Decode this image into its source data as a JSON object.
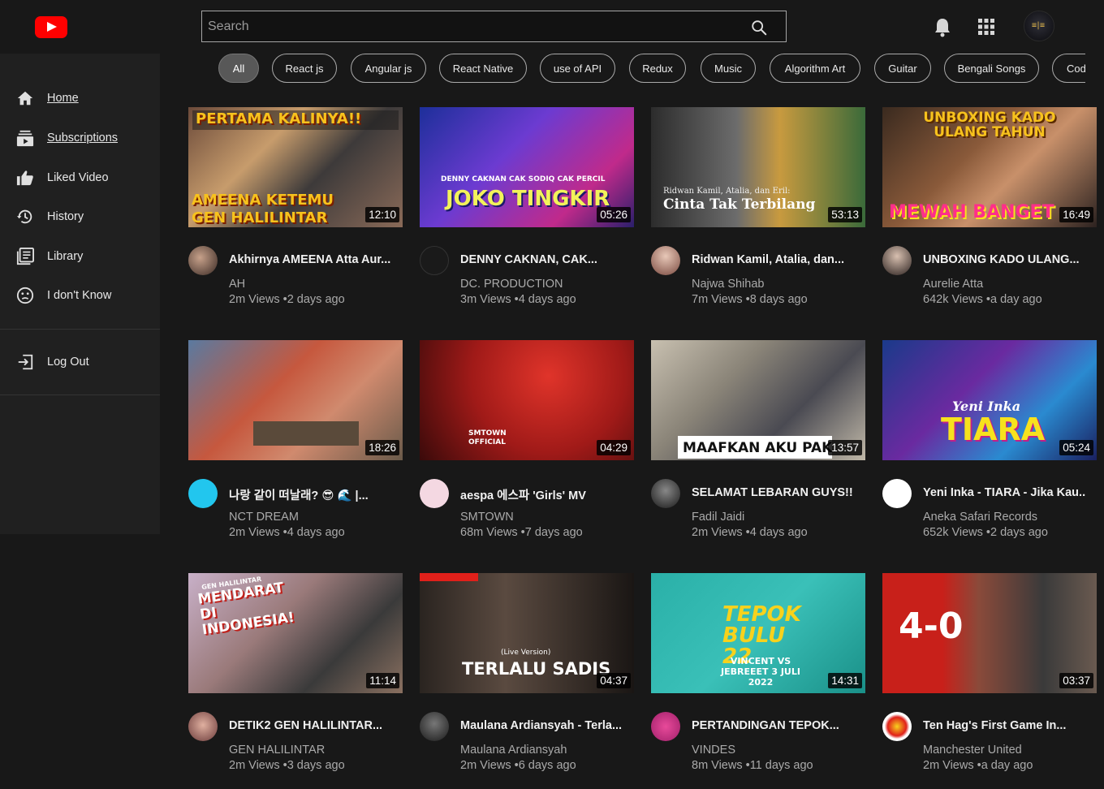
{
  "header": {
    "search_placeholder": "Search",
    "avatar_text": "≡|≡"
  },
  "sidebar": {
    "items": [
      {
        "label": "Home",
        "icon": "home-icon"
      },
      {
        "label": "Subscriptions",
        "icon": "subscriptions-icon"
      },
      {
        "label": "Liked Video",
        "icon": "thumbs-up-icon"
      },
      {
        "label": "History",
        "icon": "history-icon"
      },
      {
        "label": "Library",
        "icon": "library-icon"
      },
      {
        "label": "I don't Know",
        "icon": "confused-face-icon"
      }
    ],
    "logout_label": "Log Out"
  },
  "chips": [
    "All",
    "React js",
    "Angular js",
    "React Native",
    "use of API",
    "Redux",
    "Music",
    "Algorithm Art",
    "Guitar",
    "Bengali Songs",
    "Cod"
  ],
  "active_chip": "All",
  "videos": [
    {
      "title": "Akhirnya AMEENA Atta Aur...",
      "channel": "AH",
      "meta": "2m Views •2 days ago",
      "duration": "12:10",
      "thumb_text": "PERTAMA KALINYA!!",
      "thumb_text2": "AMEENA KETEMU GEN HALILINTAR"
    },
    {
      "title": "DENNY CAKNAN, CAK...",
      "channel": "DC. PRODUCTION",
      "meta": "3m Views •4 days ago",
      "duration": "05:26",
      "thumb_text": "JOKO TINGKIR",
      "thumb_text2": "DENNY CAKNAN   CAK SODIQ   CAK PERCIL"
    },
    {
      "title": "Ridwan Kamil, Atalia, dan...",
      "channel": "Najwa Shihab",
      "meta": "7m Views •8 days ago",
      "duration": "53:13",
      "thumb_text": "Cinta Tak Terbilang",
      "thumb_text2": "Ridwan Kamil, Atalia, dan Eril:"
    },
    {
      "title": "UNBOXING KADO ULANG...",
      "channel": "Aurelie Atta",
      "meta": "642k Views •a day ago",
      "duration": "16:49",
      "thumb_text": "UNBOXING KADO ULANG TAHUN",
      "thumb_text2": "MEWAH BANGET"
    },
    {
      "title": "나랑 같이 떠날래? 😎 🌊 |...",
      "channel": "NCT DREAM",
      "meta": "2m Views •4 days ago",
      "duration": "18:26",
      "thumb_text": "",
      "thumb_text2": ""
    },
    {
      "title": "aespa 에스파 'Girls' MV",
      "channel": "SMTOWN",
      "meta": "68m Views •7 days ago",
      "duration": "04:29",
      "thumb_text": "SMTOWN OFFICIAL",
      "thumb_text2": ""
    },
    {
      "title": "SELAMAT LEBARAN GUYS!!!",
      "channel": "Fadil Jaidi",
      "meta": "2m Views •4 days ago",
      "duration": "13:57",
      "thumb_text": "MAAFKAN AKU PAK",
      "thumb_text2": ""
    },
    {
      "title": "Yeni Inka - TIARA - Jika Kau...",
      "channel": "Aneka Safari Records",
      "meta": "652k Views •2 days ago",
      "duration": "05:24",
      "thumb_text": "TIARA",
      "thumb_text2": "Yeni Inka"
    },
    {
      "title": "DETIK2 GEN HALILINTAR...",
      "channel": "GEN HALILINTAR",
      "meta": "2m Views •3 days ago",
      "duration": "11:14",
      "thumb_text": "MENDARAT DI INDONESIA!",
      "thumb_text2": "GEN HALILINTAR"
    },
    {
      "title": "Maulana Ardiansyah - Terla...",
      "channel": "Maulana Ardiansyah",
      "meta": "2m Views •6 days ago",
      "duration": "04:37",
      "thumb_text": "TERLALU SADIS",
      "thumb_text2": "(Live Version)"
    },
    {
      "title": "PERTANDINGAN TEPOK...",
      "channel": "VINDES",
      "meta": "8m Views •11 days ago",
      "duration": "14:31",
      "thumb_text": "TEPOK BULU 22",
      "thumb_text2": "VINCENT VS JEBREEET 3 JULI 2022"
    },
    {
      "title": "Ten Hag's First Game In...",
      "channel": "Manchester United",
      "meta": "2m Views •a day ago",
      "duration": "03:37",
      "thumb_text": "4-0",
      "thumb_text2": ""
    }
  ],
  "colors": {
    "background": "#181818",
    "sidebar": "#202020",
    "accent": "#ff0000"
  }
}
